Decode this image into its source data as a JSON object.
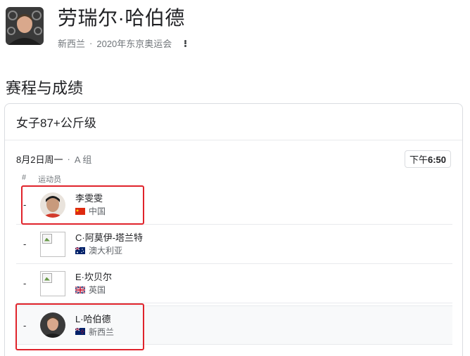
{
  "header": {
    "title": "劳瑞尔·哈伯德",
    "country": "新西兰",
    "separator": "·",
    "event": "2020年东京奥运会"
  },
  "section_title": "赛程与成绩",
  "card": {
    "title": "女子87+公斤级",
    "date": "8月2日周一",
    "dot": "·",
    "group": "A 组",
    "time_prefix": "下午",
    "time": "6:50",
    "columns": {
      "rank": "#",
      "athlete": "运动员"
    },
    "athletes": [
      {
        "rank": "-",
        "name": "李雯雯",
        "country": "中国",
        "flag": "china-flag-icon"
      },
      {
        "rank": "-",
        "name": "C·阿莫伊-塔兰特",
        "country": "澳大利亚",
        "flag": "australia-flag-icon"
      },
      {
        "rank": "-",
        "name": "E·坎贝尔",
        "country": "英国",
        "flag": "uk-flag-icon"
      },
      {
        "rank": "-",
        "name": "L·哈伯德",
        "country": "新西兰",
        "flag": "newzealand-flag-icon"
      }
    ]
  },
  "colors": {
    "highlight": "#e0232b",
    "border": "#dadce0",
    "muted": "#70757a"
  }
}
